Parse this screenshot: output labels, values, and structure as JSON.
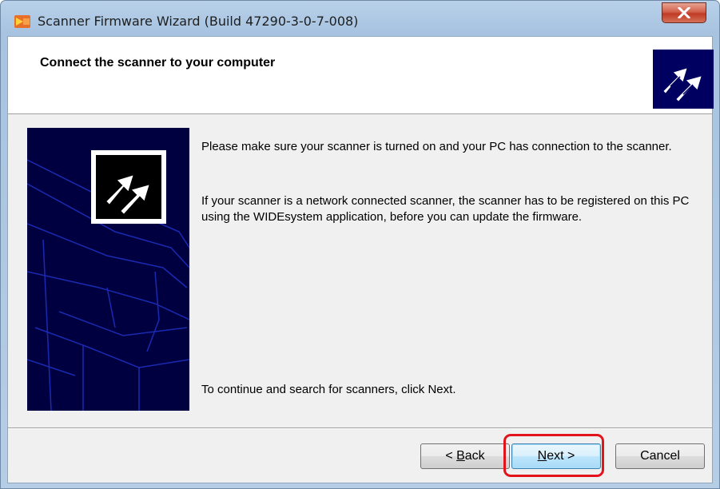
{
  "window": {
    "title": "Scanner Firmware Wizard (Build 47290-3-0-7-008)",
    "icon": "scanner-app-icon",
    "close_icon": "close-icon"
  },
  "header": {
    "title": "Connect the scanner to your computer",
    "logo_icon": "wizard-arrows-logo-icon"
  },
  "content": {
    "paragraph1": "Please make sure your scanner is turned on and your PC has connection to the scanner.",
    "paragraph2": "If your scanner is a network connected scanner, the scanner has to be registered on this PC using the WIDEsystem application, before you can update the firmware.",
    "paragraph3": "To continue and search for scanners, click Next."
  },
  "buttons": {
    "back": {
      "before": "< ",
      "mnemonic": "B",
      "after": "ack"
    },
    "next": {
      "mnemonic": "N",
      "after": "ext >"
    },
    "cancel": "Cancel"
  },
  "colors": {
    "highlight": "#e3131b",
    "logo_background": "#000060",
    "sidebar_background": "#000040"
  }
}
